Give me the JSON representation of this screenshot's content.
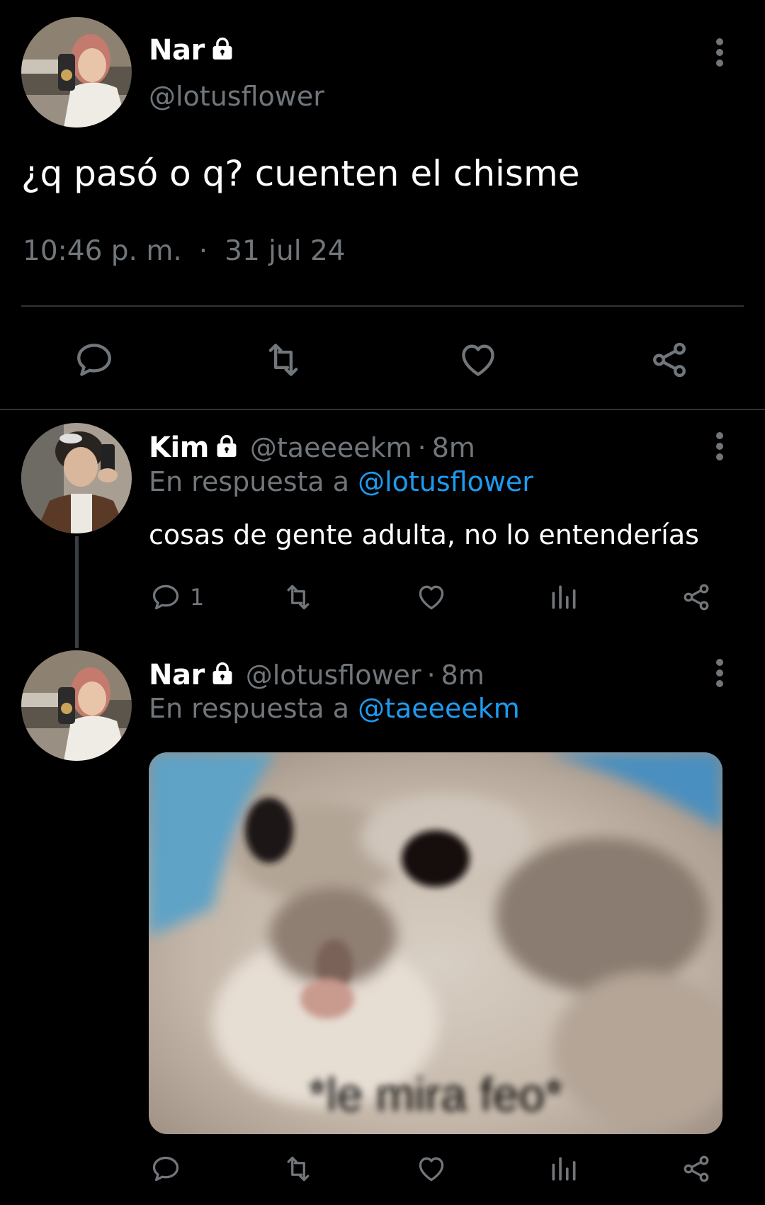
{
  "main_tweet": {
    "author_name": "Nar",
    "author_handle": "@lotusflower",
    "text": "¿q pasó o q? cuenten el chisme",
    "time": "10:46 p. m.",
    "separator": "·",
    "date": "31 jul 24",
    "actions": [
      "reply-icon",
      "retweet-icon",
      "like-icon",
      "share-icon"
    ]
  },
  "reply_1": {
    "author_name": "Kim",
    "author_handle": "@taeeeekm",
    "time_sep": "·",
    "time_ago": "8m",
    "reply_prefix": "En respuesta a",
    "reply_to": "@lotusflower",
    "text": "cosas de gente adulta, no lo entenderías",
    "reply_count": "1",
    "actions": [
      "reply-icon",
      "retweet-icon",
      "like-icon",
      "analytics-icon",
      "share-icon"
    ]
  },
  "reply_2": {
    "author_name": "Nar",
    "author_handle": "@lotusflower",
    "time_sep": "·",
    "time_ago": "8m",
    "reply_prefix": "En respuesta a",
    "reply_to": "@taeeeekm",
    "media_caption": "*le mira feo*",
    "actions": [
      "reply-icon",
      "retweet-icon",
      "like-icon",
      "analytics-icon",
      "share-icon"
    ]
  },
  "colors": {
    "background": "#000000",
    "text": "#e7e9ea",
    "muted": "#71767b",
    "link": "#1d9bf0",
    "divider": "#2f3336"
  }
}
